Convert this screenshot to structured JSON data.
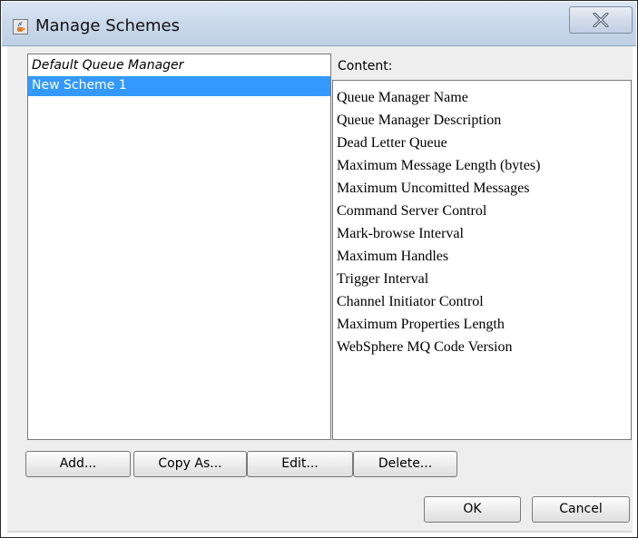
{
  "window": {
    "title": "Manage Schemes",
    "icon": "java-cup-icon",
    "close_icon": "close-x-icon"
  },
  "schemes": {
    "items": [
      {
        "label": "Default Queue Manager",
        "style": "italic",
        "selected": false
      },
      {
        "label": "New Scheme 1",
        "style": "normal",
        "selected": true
      }
    ]
  },
  "content": {
    "label": "Content:",
    "items": [
      "Queue Manager Name",
      "Queue Manager Description",
      "Dead Letter Queue",
      "Maximum Message Length (bytes)",
      "Maximum Uncomitted Messages",
      "Command Server Control",
      "Mark-browse Interval",
      "Maximum Handles",
      "Trigger Interval",
      "Channel Initiator Control",
      "Maximum Properties Length",
      "WebSphere MQ Code Version"
    ]
  },
  "actions": {
    "add": "Add...",
    "copy_as": "Copy As...",
    "edit": "Edit...",
    "delete": "Delete...",
    "ok": "OK",
    "cancel": "Cancel"
  },
  "colors": {
    "selection": "#3399ff",
    "titlebar": "#c9d8ea",
    "dialog_bg": "#eeeeee"
  }
}
